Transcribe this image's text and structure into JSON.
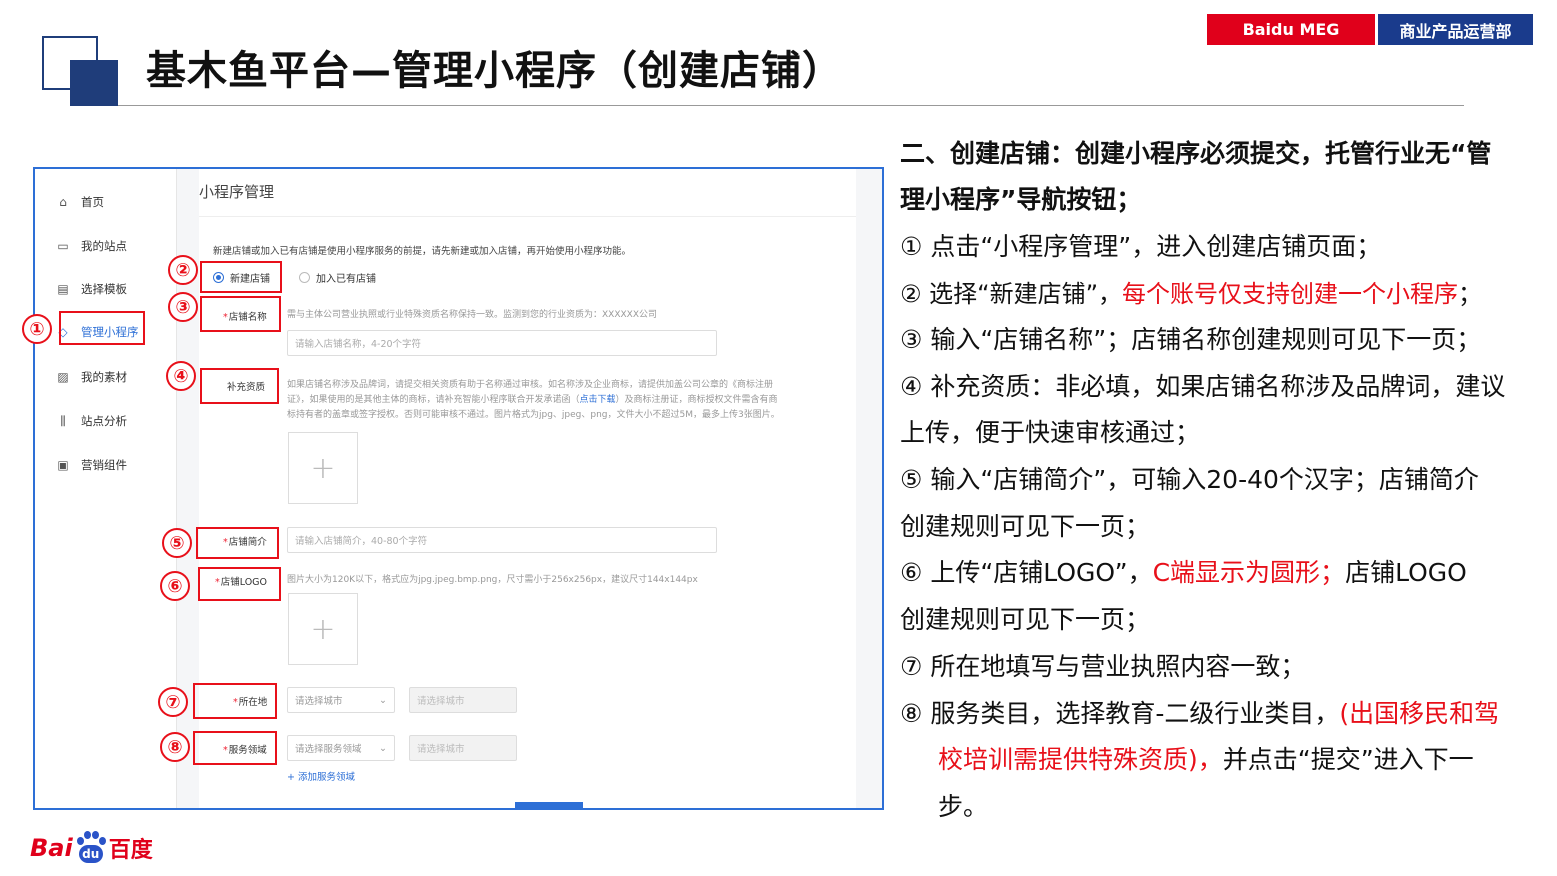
{
  "header": {
    "title": "基木鱼平台—管理小程序（创建店铺）",
    "tag_left": "Baidu MEG",
    "tag_right": "商业产品运营部"
  },
  "sidebar": {
    "items": [
      {
        "label": "首页",
        "icon": "home-icon"
      },
      {
        "label": "我的站点",
        "icon": "monitor-icon"
      },
      {
        "label": "选择模板",
        "icon": "template-icon"
      },
      {
        "label": "管理小程序",
        "icon": "diamond-icon",
        "active": true
      },
      {
        "label": "我的素材",
        "icon": "image-icon"
      },
      {
        "label": "站点分析",
        "icon": "bar-chart-icon"
      },
      {
        "label": "营销组件",
        "icon": "component-icon"
      }
    ]
  },
  "form": {
    "page_title": "小程序管理",
    "intro": "新建店铺或加入已有店铺是使用小程序服务的前提，请先新建或加入店铺，再开始使用小程序功能。",
    "radio_new": "新建店铺",
    "radio_join": "加入已有店铺",
    "name_label": "店铺名称",
    "name_hint": "需与主体公司营业执照或行业特殊资质名称保持一致。监测到您的行业资质为：XXXXXX公司",
    "name_placeholder": "请输入店铺名称，4-20个字符",
    "qual_label": "补充资质",
    "qual_hint_1": "如果店铺名称涉及品牌词，请提交相关资质有助于名称通过审核。如名称涉及企业商标，请提供加盖公司公章的《商标注册",
    "qual_hint_2a": "证》，如果使用的是其他主体的商标，请补充智能小程序联合开发承诺函（",
    "qual_hint_link": "点击下载",
    "qual_hint_2b": "）及商标注册证，商标授权文件需含有商",
    "qual_hint_3": "标持有者的盖章或签字授权。否则可能审核不通过。图片格式为jpg、jpeg、png，文件大小不超过5M，最多上传3张图片。",
    "intro_label": "店铺简介",
    "intro_placeholder": "请输入店铺简介，40-80个字符",
    "logo_label": "店铺LOGO",
    "logo_hint": "图片大小为120K以下，格式应为jpg.jpeg.bmp.png，尺寸需小于256x256px，建议尺寸144x144px",
    "upload_plus": "+",
    "loc_label": "所在地",
    "loc_select_1": "请选择城市",
    "loc_select_2": "请选择城市",
    "svc_label": "服务领域",
    "svc_select_1": "请选择服务领域",
    "svc_select_2": "请选择城市",
    "add_service": "+ 添加服务领域",
    "req_mark": "*",
    "arrow": "⌄"
  },
  "annotations": [
    "①",
    "②",
    "③",
    "④",
    "⑤",
    "⑥",
    "⑦",
    "⑧"
  ],
  "notes": {
    "l1": "二、创建店铺：创建小程序必须提交，托管行业无“管",
    "l2": "理小程序”导航按钮；",
    "l3": "① 点击“小程序管理”，进入创建店铺页面；",
    "l4a": "② 选择“新建店铺”，",
    "l4b": "每个账号仅支持创建一个小程序",
    "l4c": "；",
    "l5": "③ 输入“店铺名称”；店铺名称创建规则可见下一页；",
    "l6": "④ 补充资质：非必填，如果店铺名称涉及品牌词，建议",
    "l7": "上传，便于快速审核通过；",
    "l8": "⑤ 输入“店铺简介”，可输入20-40个汉字；店铺简介",
    "l9": "创建规则可见下一页；",
    "l10a": "⑥ 上传“店铺LOGO”，",
    "l10b": "C端显示为圆形；",
    "l10c": "店铺LOGO",
    "l11": "创建规则可见下一页；",
    "l12": "⑦ 所在地填写与营业执照内容一致；",
    "l13a": "⑧ 服务类目，选择教育-二级行业类目，",
    "l13b": "(出国移民和驾",
    "l14a": "校培训需提供特殊资质)，",
    "l14b": "并点击“提交”进入下一",
    "l15": "步。"
  },
  "logo": {
    "bai": "Bai",
    "du": "du",
    "baidu_cn": "百度"
  },
  "colors": {
    "accent_red": "#e8101a",
    "brand_blue": "#1a3b8c",
    "link_blue": "#2d6fd6"
  }
}
